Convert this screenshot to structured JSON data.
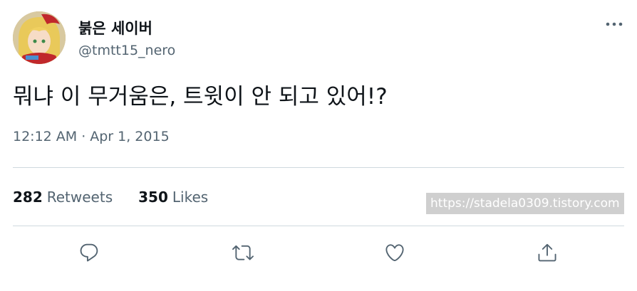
{
  "user": {
    "display_name": "붉은 세이버",
    "handle": "@tmtt15_nero",
    "avatar_icon": "anime-avatar"
  },
  "tweet": {
    "text": "뭐냐 이 무거움은, 트윗이 안 되고 있어!?",
    "time": "12:12 AM",
    "separator": "·",
    "date": "Apr 1, 2015"
  },
  "stats": {
    "retweets_count": "282",
    "retweets_label": "Retweets",
    "likes_count": "350",
    "likes_label": "Likes"
  },
  "watermark": "https://stadela0309.tistory.com",
  "icons": {
    "more": "more-icon",
    "reply": "reply-icon",
    "retweet": "retweet-icon",
    "like": "heart-icon",
    "share": "share-icon"
  },
  "colors": {
    "text_primary": "#0f1419",
    "text_secondary": "#536471",
    "divider": "#cfd9de",
    "icon": "#536471"
  }
}
